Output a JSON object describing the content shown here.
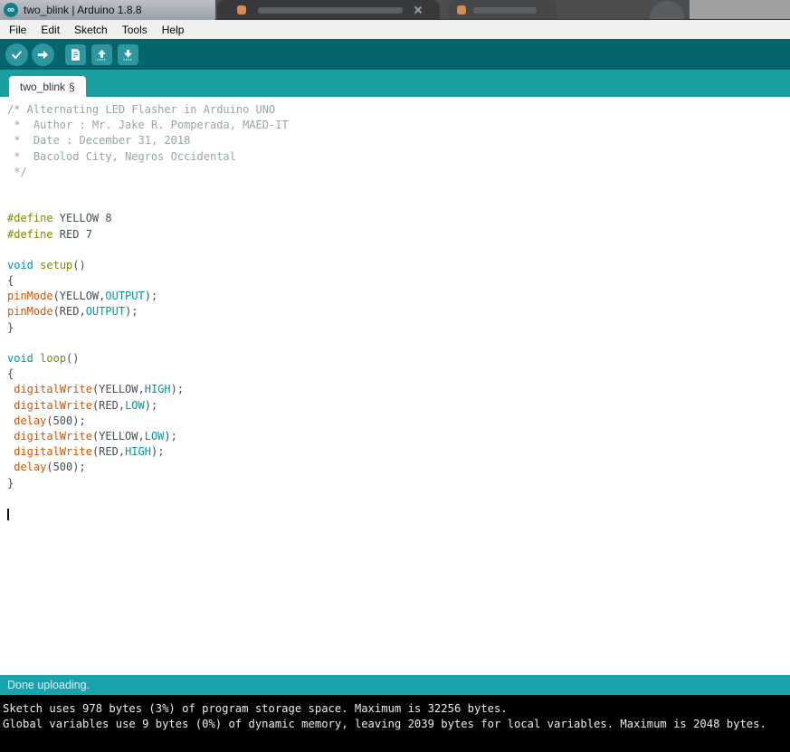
{
  "colors": {
    "toolbar_bg": "#05646C",
    "header_bg": "#17A1A3",
    "button_bg": "#2D96A0",
    "status_bg": "#18A2AC",
    "status_fg": "#E3F3F3",
    "console_bg": "#000000",
    "console_fg": "#ECECEC",
    "editor_bg": "#FFFFFF",
    "comment": "#95A5A6",
    "keyword": "#728E00",
    "type": "#00979C",
    "function": "#D35400",
    "plain": "#434F54"
  },
  "window": {
    "icon": "arduino-logo-icon",
    "icon_glyph": "∞",
    "title": "two_blink | Arduino 1.8.8"
  },
  "menu": {
    "items": [
      "File",
      "Edit",
      "Sketch",
      "Tools",
      "Help"
    ]
  },
  "toolbar": {
    "buttons": [
      {
        "name": "verify",
        "icon": "check-icon",
        "shape": "round"
      },
      {
        "name": "upload",
        "icon": "arrow-right-icon",
        "shape": "round"
      },
      {
        "name": "new",
        "icon": "document-icon",
        "shape": "square"
      },
      {
        "name": "open",
        "icon": "arrow-up-icon",
        "shape": "square"
      },
      {
        "name": "save",
        "icon": "arrow-down-icon",
        "shape": "square"
      }
    ]
  },
  "tabs": [
    {
      "label": "two_blink",
      "suffix": "§"
    }
  ],
  "editor": {
    "code_lines": [
      [
        {
          "c": "cm",
          "t": "/* Alternating LED Flasher in Arduino UNO"
        }
      ],
      [
        {
          "c": "cm",
          "t": " *  Author : Mr. Jake R. Pomperada, MAED-IT"
        }
      ],
      [
        {
          "c": "cm",
          "t": " *  Date : December 31, 2018"
        }
      ],
      [
        {
          "c": "cm",
          "t": " *  Bacolod City, Negros Occidental"
        }
      ],
      [
        {
          "c": "cm",
          "t": " */"
        }
      ],
      [],
      [],
      [
        {
          "c": "kw",
          "t": "#define"
        },
        {
          "c": "pl",
          "t": " YELLOW 8"
        }
      ],
      [
        {
          "c": "kw",
          "t": "#define"
        },
        {
          "c": "pl",
          "t": " RED 7"
        }
      ],
      [],
      [
        {
          "c": "ty",
          "t": "void"
        },
        {
          "c": "pl",
          "t": " "
        },
        {
          "c": "kw",
          "t": "setup"
        },
        {
          "c": "pl",
          "t": "()"
        }
      ],
      [
        {
          "c": "pl",
          "t": "{"
        }
      ],
      [
        {
          "c": "fn",
          "t": "pinMode"
        },
        {
          "c": "pl",
          "t": "(YELLOW,"
        },
        {
          "c": "ty",
          "t": "OUTPUT"
        },
        {
          "c": "pl",
          "t": ");"
        }
      ],
      [
        {
          "c": "fn",
          "t": "pinMode"
        },
        {
          "c": "pl",
          "t": "(RED,"
        },
        {
          "c": "ty",
          "t": "OUTPUT"
        },
        {
          "c": "pl",
          "t": ");"
        }
      ],
      [
        {
          "c": "pl",
          "t": "}"
        }
      ],
      [],
      [
        {
          "c": "ty",
          "t": "void"
        },
        {
          "c": "pl",
          "t": " "
        },
        {
          "c": "kw",
          "t": "loop"
        },
        {
          "c": "pl",
          "t": "()"
        }
      ],
      [
        {
          "c": "pl",
          "t": "{"
        }
      ],
      [
        {
          "c": "pl",
          "t": " "
        },
        {
          "c": "fn",
          "t": "digitalWrite"
        },
        {
          "c": "pl",
          "t": "(YELLOW,"
        },
        {
          "c": "ty",
          "t": "HIGH"
        },
        {
          "c": "pl",
          "t": ");"
        }
      ],
      [
        {
          "c": "pl",
          "t": " "
        },
        {
          "c": "fn",
          "t": "digitalWrite"
        },
        {
          "c": "pl",
          "t": "(RED,"
        },
        {
          "c": "ty",
          "t": "LOW"
        },
        {
          "c": "pl",
          "t": ");"
        }
      ],
      [
        {
          "c": "pl",
          "t": " "
        },
        {
          "c": "fn",
          "t": "delay"
        },
        {
          "c": "pl",
          "t": "(500);"
        }
      ],
      [
        {
          "c": "pl",
          "t": " "
        },
        {
          "c": "fn",
          "t": "digitalWrite"
        },
        {
          "c": "pl",
          "t": "(YELLOW,"
        },
        {
          "c": "ty",
          "t": "LOW"
        },
        {
          "c": "pl",
          "t": ");"
        }
      ],
      [
        {
          "c": "pl",
          "t": " "
        },
        {
          "c": "fn",
          "t": "digitalWrite"
        },
        {
          "c": "pl",
          "t": "(RED,"
        },
        {
          "c": "ty",
          "t": "HIGH"
        },
        {
          "c": "pl",
          "t": ");"
        }
      ],
      [
        {
          "c": "pl",
          "t": " "
        },
        {
          "c": "fn",
          "t": "delay"
        },
        {
          "c": "pl",
          "t": "(500);"
        }
      ],
      [
        {
          "c": "pl",
          "t": "}"
        }
      ],
      [],
      [
        {
          "c": "caret",
          "t": ""
        }
      ]
    ]
  },
  "status_bar": {
    "message": "Done uploading."
  },
  "console": {
    "lines": [
      "Sketch uses 978 bytes (3%) of program storage space. Maximum is 32256 bytes.",
      "Global variables use 9 bytes (0%) of dynamic memory, leaving 2039 bytes for local variables. Maximum is 2048 bytes."
    ]
  }
}
